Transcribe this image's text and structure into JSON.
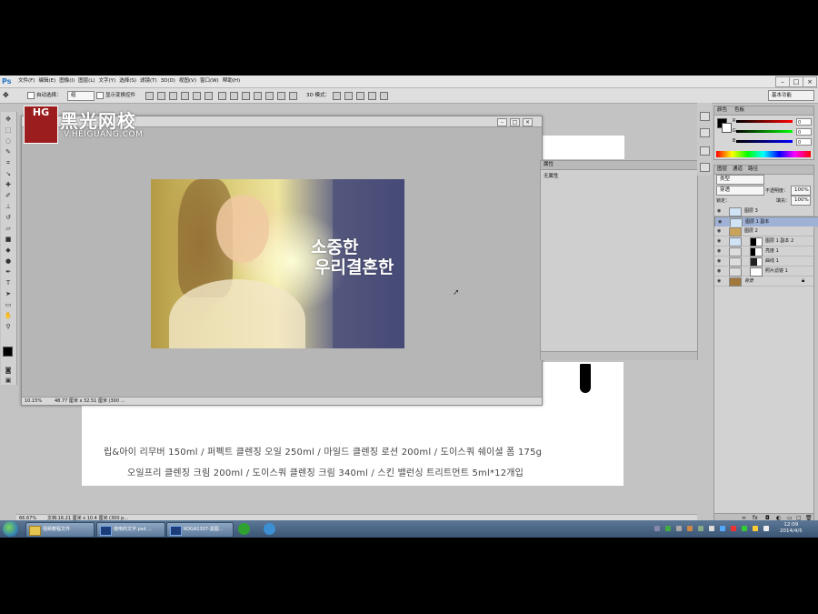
{
  "app": {
    "logo": "Ps"
  },
  "menu": [
    "文件(F)",
    "编辑(E)",
    "图像(I)",
    "图层(L)",
    "文字(Y)",
    "选择(S)",
    "滤镜(T)",
    "3D(D)",
    "视图(V)",
    "窗口(W)",
    "帮助(H)"
  ],
  "options": {
    "auto_select": "自动选择：",
    "auto_select_target": "组",
    "show_transform": "显示变换控件",
    "mode_3d": "3D 模式：",
    "workspace": "基本功能"
  },
  "watermark": {
    "badge": "HG",
    "title": "黑光网校",
    "url": "V.HEIGUANG.COM"
  },
  "doc_window": {
    "photo_text_line1": "소중한",
    "photo_text_line2": "우리결혼한",
    "zoom": "10.15%",
    "doc_info": "48.77 厘米 x 32.51 厘米 (300 ..."
  },
  "background_doc": {
    "line1": "립&아이 리무버 150ml / 퍼펙트 클렌징 오일 250ml / 마일드 클렌징 로션 200ml / 도이스쿼 쉐이셜 폼 175g",
    "line2": "오일프리 클렌징 크림 200ml / 도이스쿼 클렌징 크림 340ml / 스킨 밸런싱 트리트먼트 5ml*12개입"
  },
  "properties": {
    "tab": "属性",
    "subtitle": "无属性"
  },
  "color_panel": {
    "tab_color": "颜色",
    "tab_swatches": "色板",
    "r_label": "R",
    "g_label": "G",
    "b_label": "B",
    "r": "0",
    "g": "0",
    "b": "0"
  },
  "layers_panel": {
    "tab_layers": "图层",
    "tab_channels": "通道",
    "tab_paths": "路径",
    "filter_kind": "类型",
    "blend": "穿透",
    "opacity_label": "不透明度：",
    "opacity": "100%",
    "lock_label": "锁定：",
    "fill_label": "填充：",
    "fill": "100%",
    "items": [
      {
        "name": "图层 3",
        "selected": false
      },
      {
        "name": "图层 1 副本",
        "selected": true
      },
      {
        "name": "图层 2",
        "selected": false
      },
      {
        "name": "图层 1 副本 2",
        "selected": false
      },
      {
        "name": "亮度 1",
        "selected": false
      },
      {
        "name": "曲线 1",
        "selected": false
      },
      {
        "name": "照片滤镜 1",
        "selected": false
      },
      {
        "name": "背景",
        "selected": false
      }
    ]
  },
  "main_status": {
    "zoom": "66.67%",
    "doc_info": "文档:16.21 厘米 x 10.4 厘米 (300 p..."
  },
  "taskbar": {
    "tasks": [
      "视频教程文件",
      "使用的文字.psd ...",
      "KOGA1307-黑图..."
    ],
    "time": "12:09",
    "date": "2014/4/5"
  }
}
